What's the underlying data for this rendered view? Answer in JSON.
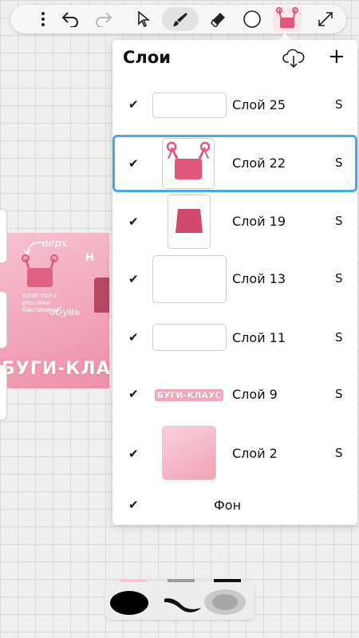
{
  "toolbar": {
    "items": [
      "more-icon",
      "undo-icon",
      "redo-icon",
      "select-arrow-icon",
      "brush-icon",
      "eraser-icon",
      "color-circle-icon",
      "current-image-thumbnail",
      "fullscreen-icon"
    ],
    "active": "brush-icon"
  },
  "artwork": {
    "top_label": "верх",
    "note_left": "кроп топ с рюшами бантиками",
    "shoes_label": "обувь",
    "banner": "БУГИ-КЛАУС"
  },
  "layers_panel": {
    "title": "Слои",
    "add_symbol": "+",
    "layers": [
      {
        "name": "Слой 25",
        "visible": true,
        "mode": "S",
        "selected": false
      },
      {
        "name": "Слой 22",
        "visible": true,
        "mode": "S",
        "selected": true
      },
      {
        "name": "Слой 19",
        "visible": true,
        "mode": "S",
        "selected": false
      },
      {
        "name": "Слой 13",
        "visible": true,
        "mode": "S",
        "selected": false
      },
      {
        "name": "Слой 11",
        "visible": true,
        "mode": "S",
        "selected": false
      },
      {
        "name": "Слой 9",
        "visible": true,
        "mode": "S",
        "selected": false
      },
      {
        "name": "Слой 2",
        "visible": true,
        "mode": "S",
        "selected": false
      }
    ],
    "background": {
      "name": "Фон",
      "visible": true
    },
    "check_symbol": "✔",
    "layer9_thumb_text": "БУГИ-КЛАУС"
  },
  "colors": {
    "accent": "#4aa8e8",
    "pink": "#f2a6bb",
    "dark_pink": "#e0587a"
  }
}
